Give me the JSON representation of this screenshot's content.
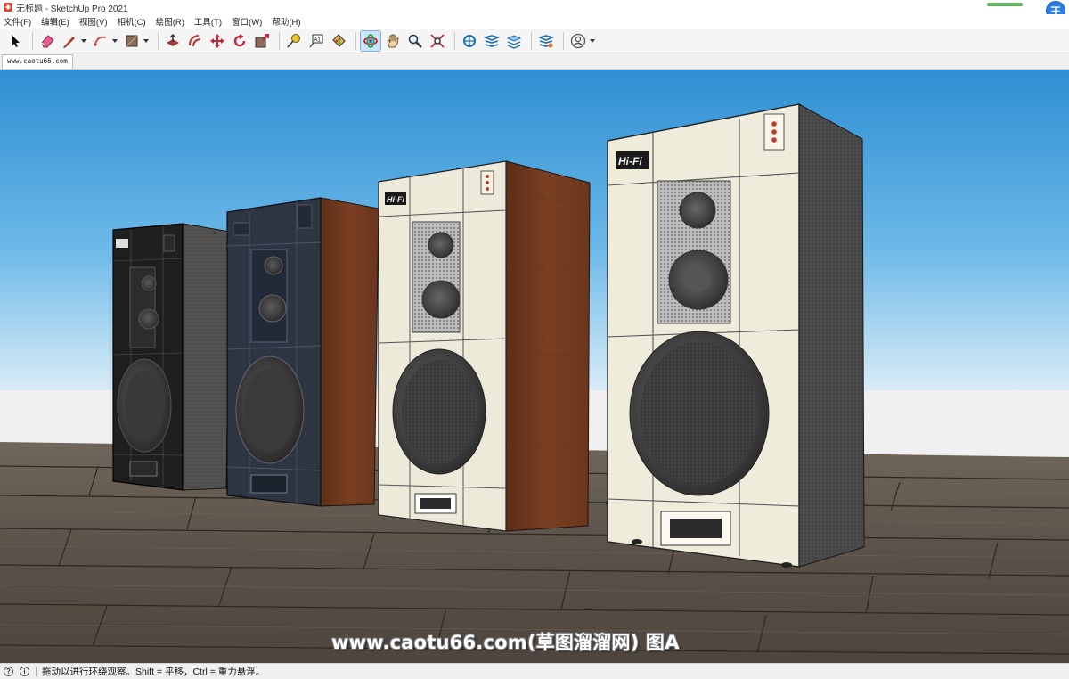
{
  "window": {
    "title": "无标题 - SketchUp Pro 2021",
    "user_initial": "王"
  },
  "menu": {
    "items": [
      {
        "label": "文件(F)"
      },
      {
        "label": "编辑(E)"
      },
      {
        "label": "视图(V)"
      },
      {
        "label": "相机(C)"
      },
      {
        "label": "绘图(R)"
      },
      {
        "label": "工具(T)"
      },
      {
        "label": "窗口(W)"
      },
      {
        "label": "帮助(H)"
      }
    ]
  },
  "toolbar": {
    "tools": [
      {
        "name": "select-tool",
        "icon": "arrow-icon"
      },
      {
        "name": "eraser-tool",
        "icon": "eraser-icon"
      },
      {
        "name": "line-tool",
        "icon": "pencil-icon"
      },
      {
        "name": "arc-tool",
        "icon": "arc-icon"
      },
      {
        "name": "shape-tool",
        "icon": "rectangle-icon"
      },
      {
        "name": "push-pull-tool",
        "icon": "push-pull-icon"
      },
      {
        "name": "offset-tool",
        "icon": "offset-icon"
      },
      {
        "name": "move-tool",
        "icon": "move-icon"
      },
      {
        "name": "rotate-tool",
        "icon": "rotate-icon"
      },
      {
        "name": "scale-tool",
        "icon": "scale-icon"
      },
      {
        "name": "tape-measure-tool",
        "icon": "tape-measure-icon"
      },
      {
        "name": "text-tool",
        "icon": "text-icon"
      },
      {
        "name": "paint-bucket-tool",
        "icon": "paint-bucket-icon"
      },
      {
        "name": "orbit-tool",
        "icon": "orbit-icon",
        "active": true
      },
      {
        "name": "pan-tool",
        "icon": "hand-icon"
      },
      {
        "name": "zoom-tool",
        "icon": "magnifier-icon"
      },
      {
        "name": "zoom-extents-tool",
        "icon": "zoom-extents-icon"
      },
      {
        "name": "warehouse-tool",
        "icon": "warehouse-icon"
      },
      {
        "name": "extension-warehouse-tool",
        "icon": "extension-icon"
      },
      {
        "name": "layout-tool",
        "icon": "layout-icon"
      },
      {
        "name": "extension-manager-tool",
        "icon": "extension-manager-icon"
      },
      {
        "name": "account-tool",
        "icon": "user-icon"
      }
    ]
  },
  "scene": {
    "tab_label": "www.caotu66.com",
    "sky_color": "#3d9ad6",
    "floor_color": "#5d544a",
    "watermark": "www.caotu66.com(草图溜溜网) 图A",
    "logo_text": "Hi-Fi"
  },
  "status": {
    "message": "拖动以进行环绕观察。Shift = 平移，Ctrl = 重力悬浮。"
  }
}
